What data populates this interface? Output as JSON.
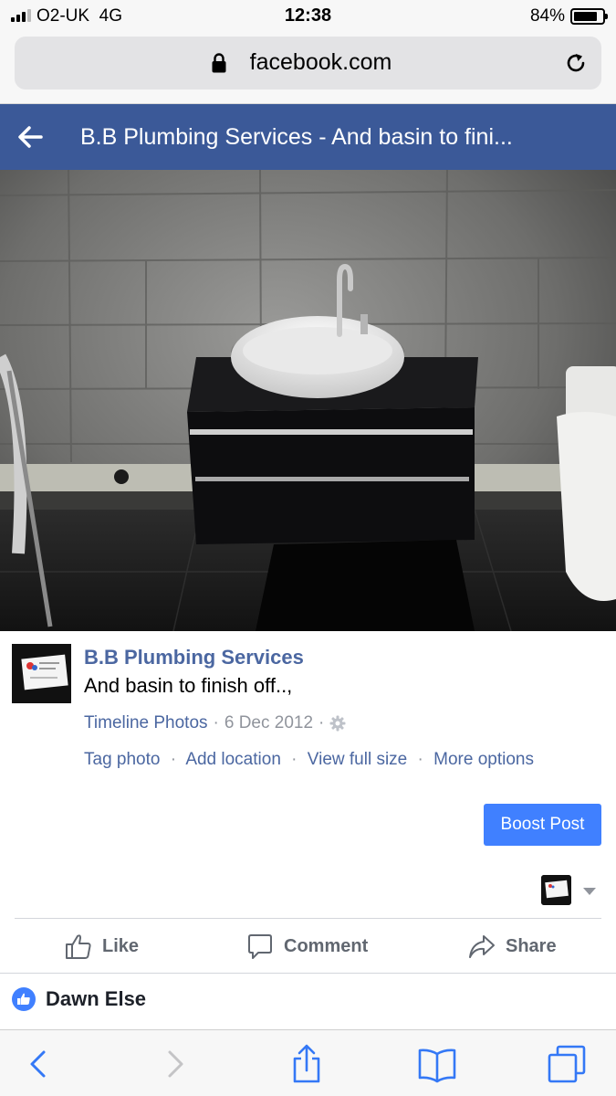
{
  "status_bar": {
    "carrier": "O2-UK",
    "network": "4G",
    "time": "12:38",
    "battery_percent": "84%",
    "battery_level": 0.84,
    "signal_bars": 3,
    "signal_bars_total": 4
  },
  "browser": {
    "url": "facebook.com",
    "icons": [
      "lock-icon",
      "reload-icon"
    ],
    "toolbar_icons": [
      "back-icon",
      "forward-icon",
      "share-icon",
      "bookmarks-icon",
      "tabs-icon"
    ]
  },
  "header": {
    "title": "B.B Plumbing Services - And basin to fini..."
  },
  "post": {
    "page_name": "B.B Plumbing Services",
    "text": "And basin to finish off..,",
    "album": "Timeline Photos",
    "date": "6 Dec 2012",
    "separator": "·",
    "actions": [
      "Tag photo",
      "Add location",
      "View full size",
      "More options"
    ],
    "boost_label": "Boost Post"
  },
  "action_bar": {
    "like": "Like",
    "comment": "Comment",
    "share": "Share"
  },
  "reactions": {
    "name": "Dawn Else"
  },
  "colors": {
    "fb_blue": "#3b5998",
    "link_blue": "#4b67a1",
    "boost_blue": "#4080ff",
    "like_badge": "#4080ff",
    "safari_blue": "#3478f6"
  }
}
